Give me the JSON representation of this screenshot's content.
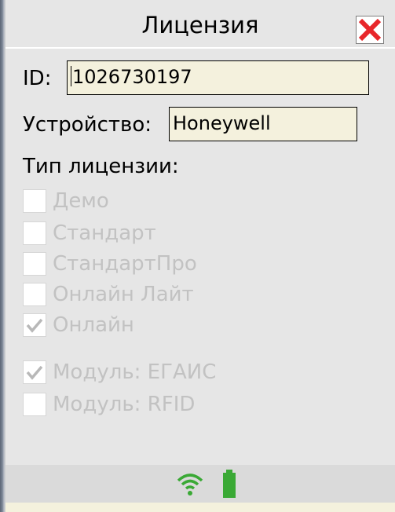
{
  "window": {
    "title": "Лицензия",
    "close_icon": "close-x-icon",
    "close_color": "#e8262a"
  },
  "form": {
    "id_label": "ID:",
    "id_value": "1026730197",
    "device_label": "Устройство:",
    "device_value": "Honeywell",
    "license_type_label": "Тип лицензии:"
  },
  "license_options": [
    {
      "label": "Демо",
      "checked": false,
      "enabled": false
    },
    {
      "label": "Стандарт",
      "checked": false,
      "enabled": false
    },
    {
      "label": "СтандартПро",
      "checked": false,
      "enabled": false
    },
    {
      "label": "Онлайн Лайт",
      "checked": false,
      "enabled": false
    },
    {
      "label": "Онлайн",
      "checked": true,
      "enabled": false
    }
  ],
  "module_options": [
    {
      "label": "Модуль: ЕГАИС",
      "checked": true,
      "enabled": false
    },
    {
      "label": "Модуль: RFID",
      "checked": false,
      "enabled": false
    }
  ],
  "status_bar": {
    "wifi_icon": "wifi-icon",
    "battery_icon": "battery-icon",
    "accent_color": "#3aa935"
  }
}
